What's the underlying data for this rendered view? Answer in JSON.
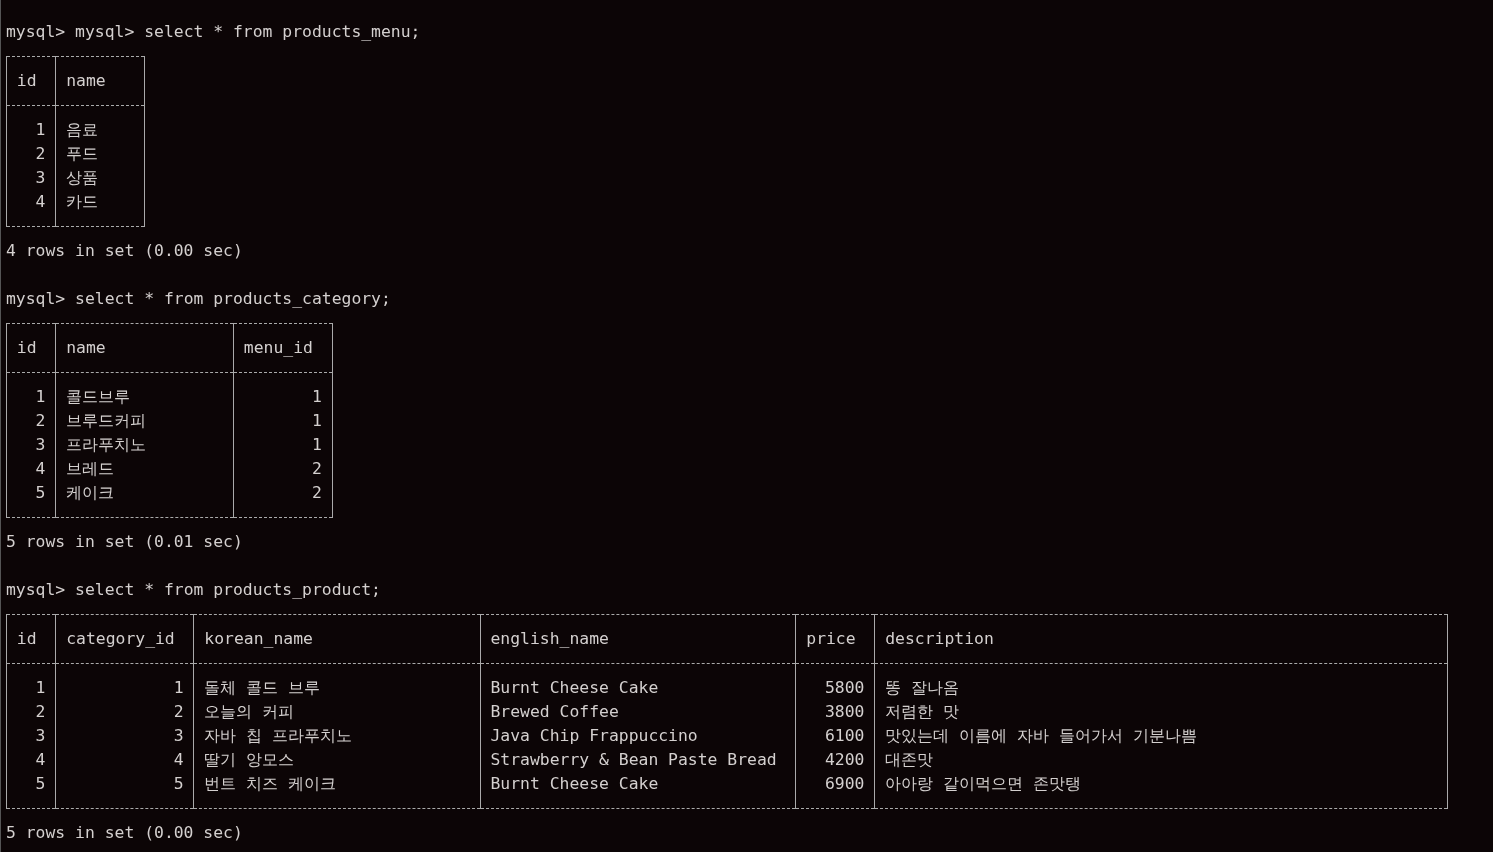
{
  "queries": [
    {
      "prompt": "mysql> mysql>",
      "command": "select * from products_menu;",
      "columns": [
        {
          "name": "id",
          "kind": "number"
        },
        {
          "name": "name",
          "kind": "text"
        }
      ],
      "rows": [
        [
          "1",
          "음료"
        ],
        [
          "2",
          "푸드"
        ],
        [
          "3",
          "상품"
        ],
        [
          "4",
          "카드"
        ]
      ],
      "footer": "4 rows in set (0.00 sec)"
    },
    {
      "prompt": "mysql>",
      "command": "select * from products_category;",
      "columns": [
        {
          "name": "id",
          "kind": "number"
        },
        {
          "name": "name",
          "kind": "text"
        },
        {
          "name": "menu_id",
          "kind": "number"
        }
      ],
      "rows": [
        [
          "1",
          "콜드브루",
          "1"
        ],
        [
          "2",
          "브루드커피",
          "1"
        ],
        [
          "3",
          "프라푸치노",
          "1"
        ],
        [
          "4",
          "브레드",
          "2"
        ],
        [
          "5",
          "케이크",
          "2"
        ]
      ],
      "footer": "5 rows in set (0.01 sec)"
    },
    {
      "prompt": "mysql>",
      "command": "select * from products_product;",
      "columns": [
        {
          "name": "id",
          "kind": "number"
        },
        {
          "name": "category_id",
          "kind": "number"
        },
        {
          "name": "korean_name",
          "kind": "text"
        },
        {
          "name": "english_name",
          "kind": "text"
        },
        {
          "name": "price",
          "kind": "number"
        },
        {
          "name": "description",
          "kind": "text"
        }
      ],
      "rows": [
        [
          "1",
          "1",
          "돌체 콜드 브루",
          "Burnt Cheese Cake",
          "5800",
          "똥 잘나옴"
        ],
        [
          "2",
          "2",
          "오늘의 커피",
          "Brewed Coffee",
          "3800",
          "저렴한 맛"
        ],
        [
          "3",
          "3",
          "자바 칩 프라푸치노",
          "Java Chip Frappuccino",
          "6100",
          "맛있는데 이름에 자바 들어가서 기분나쁨"
        ],
        [
          "4",
          "4",
          "딸기 앙모스",
          "Strawberry & Bean Paste Bread",
          "4200",
          "대존맛"
        ],
        [
          "5",
          "5",
          "번트 치즈 케이크",
          "Burnt Cheese Cake",
          "6900",
          "아아랑 같이먹으면 존맛탱"
        ]
      ],
      "footer": "5 rows in set (0.00 sec)"
    }
  ]
}
